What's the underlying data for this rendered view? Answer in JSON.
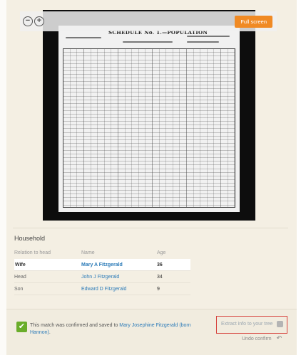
{
  "viewer": {
    "zoom_out_glyph": "−",
    "zoom_in_glyph": "+",
    "fullscreen_label": "Full screen",
    "scan_title": "SCHEDULE No. 1.—POPULATION"
  },
  "household": {
    "title": "Household",
    "columns": [
      "Relation to head",
      "Name",
      "Age"
    ],
    "rows": [
      {
        "relation": "Wife",
        "name": "Mary A Fitzgerald",
        "age": "36"
      },
      {
        "relation": "Head",
        "name": "John J Fitzgerald",
        "age": "34"
      },
      {
        "relation": "Son",
        "name": "Edward D Fitzgerald",
        "age": "9"
      }
    ]
  },
  "confirm": {
    "text_prefix": "This match was confirmed and saved to ",
    "person_link": "Mary Josephine Fitzgerald (born Hannon)",
    "text_suffix": ".",
    "extract_label": "Extract info to your tree",
    "undo_label": "Undo confirm"
  },
  "colors": {
    "accent_orange": "#f08a24",
    "link_blue": "#2a7ab8",
    "check_green": "#6aad2a",
    "highlight_red": "#d7443e"
  },
  "icons": [
    "zoom-out-icon",
    "zoom-in-icon",
    "checkmark-icon",
    "tree-icon",
    "undo-icon"
  ]
}
